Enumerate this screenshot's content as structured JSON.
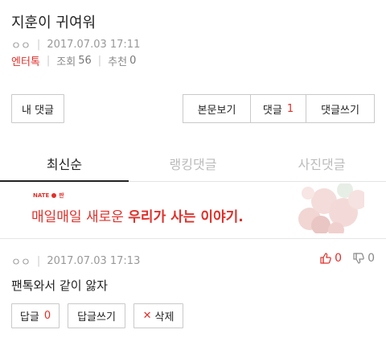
{
  "post": {
    "title": "지훈이 귀여워",
    "author": "ㅇㅇ",
    "datetime": "2017.07.03 17:11",
    "category": "엔터톡",
    "views_label": "조회",
    "views": "56",
    "recommend_label": "추천",
    "recommend": "0"
  },
  "actions": {
    "my_comments": "내 댓글",
    "view_post": "본문보기",
    "comments_label": "댓글",
    "comments_count": "1",
    "write_comment": "댓글쓰기"
  },
  "tabs": [
    "최신순",
    "랭킹댓글",
    "사진댓글"
  ],
  "banner": {
    "brand": "NATE",
    "brand_sub": "판",
    "slogan_plain": "매일매일 새로운 ",
    "slogan_bold": "우리가 사는 이야기."
  },
  "comment": {
    "author": "ㅇㅇ",
    "datetime": "2017.07.03 17:13",
    "upvotes": "0",
    "downvotes": "0",
    "text": "팬톡와서 같이 앓자",
    "reply_label": "답글",
    "reply_count": "0",
    "write_reply": "답글쓰기",
    "delete": "삭제"
  },
  "colors": {
    "accent": "#e0302a",
    "muted": "#999999",
    "border": "#c9c9c9"
  }
}
